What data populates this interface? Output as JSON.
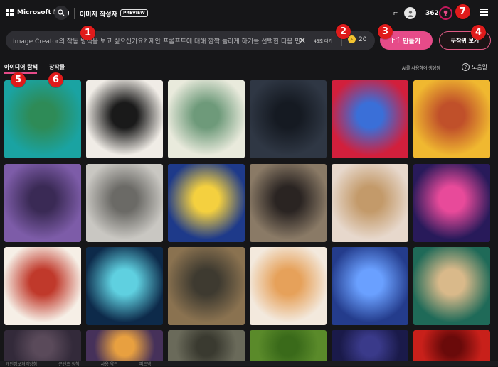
{
  "header": {
    "brand": "Microsoft Bing",
    "app_title": "이미지 작성자",
    "preview_badge": "PREVIEW",
    "user_initials": "rr",
    "points": "362"
  },
  "prompt": {
    "placeholder": "Image Creator의 작동 방식을 보고 싶으신가요? 제안 프롬프트에 대해 깜짝 놀라게 하기를 선택한 다음 만",
    "wait_label": "45초 대기",
    "boost_count": "20",
    "create_label": "만들기",
    "surprise_label": "무작위 보기"
  },
  "tabs": [
    {
      "label": "아이디어 탐색",
      "active": true
    },
    {
      "label": "창작물",
      "active": false
    }
  ],
  "notice": {
    "ai_generated": "AI를 사용하여 생성됨",
    "help": "도움말"
  },
  "markers": [
    "1",
    "2",
    "3",
    "4",
    "5",
    "6",
    "7"
  ],
  "gallery": [
    {
      "name": "teal-number-2",
      "colors": [
        "#1aa3a2",
        "#2e8b57"
      ]
    },
    {
      "name": "abstract-shapes",
      "colors": [
        "#f0ece6",
        "#1a1a1a"
      ]
    },
    {
      "name": "succulent-bouquet",
      "colors": [
        "#e9eadc",
        "#6e9a7a"
      ]
    },
    {
      "name": "dark-castle",
      "colors": [
        "#2f3744",
        "#151a22"
      ]
    },
    {
      "name": "colorful-eye-makeup",
      "colors": [
        "#d21f3c",
        "#3a6fd8"
      ]
    },
    {
      "name": "dog-astronaut",
      "colors": [
        "#f0b830",
        "#c0502a"
      ]
    },
    {
      "name": "purple-robot",
      "colors": [
        "#7d5ca8",
        "#3a2a55"
      ]
    },
    {
      "name": "ruined-city",
      "colors": [
        "#c9c7c2",
        "#6b6a66"
      ]
    },
    {
      "name": "lemon-surreal",
      "colors": [
        "#1e3a8a",
        "#f4d03f"
      ]
    },
    {
      "name": "elephant-tuxedo",
      "colors": [
        "#8a7a66",
        "#2a2422"
      ]
    },
    {
      "name": "gold-ring",
      "colors": [
        "#e7d8cc",
        "#c39a6a"
      ]
    },
    {
      "name": "cosmic-figure",
      "colors": [
        "#281a5a",
        "#e84a9a"
      ]
    },
    {
      "name": "cozy-room",
      "colors": [
        "#f6efe6",
        "#c0392b"
      ]
    },
    {
      "name": "hamster-crystal-ball",
      "colors": [
        "#0d2a4a",
        "#5fd0e0"
      ]
    },
    {
      "name": "ruined-building",
      "colors": [
        "#8a7250",
        "#3e3a30"
      ]
    },
    {
      "name": "cocktail-glass",
      "colors": [
        "#f3e9dd",
        "#e6a15a"
      ]
    },
    {
      "name": "blue-dahlia",
      "colors": [
        "#243c8c",
        "#6aa0ff"
      ]
    },
    {
      "name": "terrarium-bowl",
      "colors": [
        "#1f6a58",
        "#d9b98a"
      ]
    },
    {
      "name": "dark-forest",
      "colors": [
        "#332a3a",
        "#5a4a5a"
      ]
    },
    {
      "name": "pancakes",
      "colors": [
        "#46315a",
        "#e8a040"
      ]
    },
    {
      "name": "rocks",
      "colors": [
        "#6a6a5a",
        "#3a3a30"
      ]
    },
    {
      "name": "green-field",
      "colors": [
        "#5a8a2a",
        "#3a6a1a"
      ]
    },
    {
      "name": "night-city",
      "colors": [
        "#1a1a4a",
        "#3a3a8a"
      ]
    },
    {
      "name": "strawberries",
      "colors": [
        "#c8201a",
        "#6a0a0a"
      ]
    }
  ],
  "footer": [
    "개인정보처리방침",
    "콘텐츠 정책",
    "사용 약관",
    "피드백"
  ]
}
